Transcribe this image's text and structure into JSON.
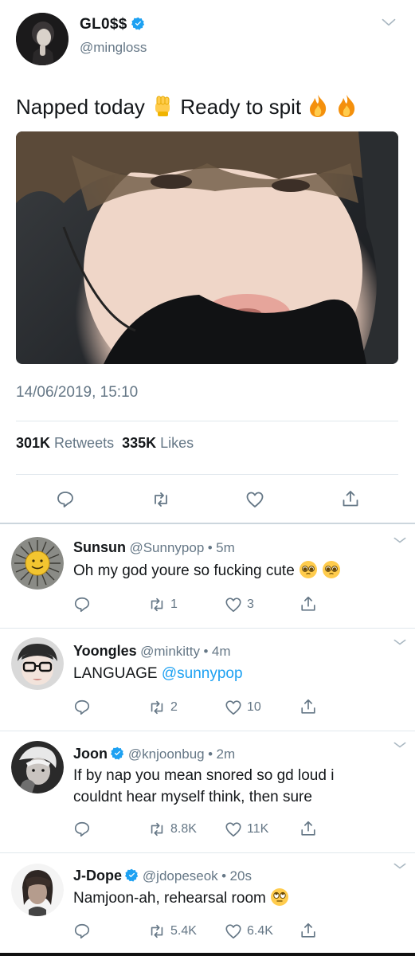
{
  "main_tweet": {
    "display_name": "GL0$$",
    "handle": "@mingloss",
    "text": "Napped today",
    "text_part2": "Ready to spit",
    "timestamp": "14/06/2019, 15:10",
    "retweets_count": "301K",
    "retweets_label": "Retweets",
    "likes_count": "335K",
    "likes_label": "Likes"
  },
  "replies": [
    {
      "display_name": "Sunsun",
      "handle": "@Sunnypop",
      "time": "5m",
      "text": "Oh my god youre so fucking cute",
      "retweets": "1",
      "likes": "3"
    },
    {
      "display_name": "Yoongles",
      "handle": "@minkitty",
      "time": "4m",
      "text": "LANGUAGE",
      "mention": "@sunnypop",
      "retweets": "2",
      "likes": "10"
    },
    {
      "display_name": "Joon",
      "handle": "@knjoonbug",
      "time": "2m",
      "text_line1": "If by nap you mean snored so gd loud i",
      "text_line2": "couldnt hear myself think, then sure",
      "retweets": "8.8K",
      "likes": "11K"
    },
    {
      "display_name": "J-Dope",
      "handle": "@jdopeseok",
      "time": "20s",
      "text": "Namjoon-ah, rehearsal room",
      "retweets": "5.4K",
      "likes": "6.4K"
    }
  ],
  "separator": "•",
  "colors": {
    "accent": "#1da1f2",
    "muted": "#657786",
    "divider": "#e1e8ed"
  },
  "icons": [
    "reply-icon",
    "retweet-icon",
    "like-icon",
    "share-icon",
    "chevron-down-icon",
    "verified-badge-icon",
    "raised-fist-emoji",
    "fire-emoji",
    "pleading-face-emoji",
    "eye-roll-emoji"
  ]
}
